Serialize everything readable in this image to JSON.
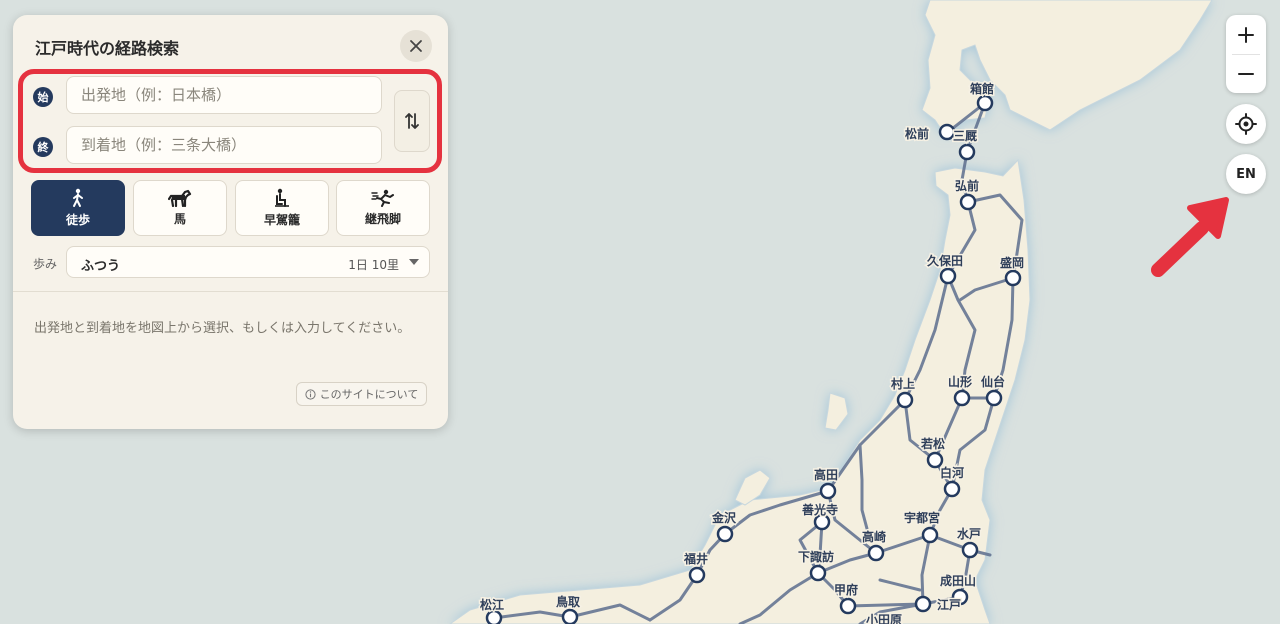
{
  "panel": {
    "title": "江戸時代の経路検索",
    "start": {
      "pin": "始",
      "placeholder": "出発地（例：日本橋）",
      "value": ""
    },
    "end": {
      "pin": "終",
      "placeholder": "到着地（例：三条大橋）",
      "value": ""
    },
    "modes": [
      {
        "label": "徒歩",
        "icon": "walking-person-icon",
        "active": true
      },
      {
        "label": "馬",
        "icon": "horse-icon",
        "active": false
      },
      {
        "label": "早駕籠",
        "icon": "palanquin-icon",
        "active": false
      },
      {
        "label": "継飛脚",
        "icon": "running-courier-icon",
        "active": false
      }
    ],
    "pace": {
      "label": "歩み",
      "value": "ふつう",
      "rate": "1日 10里"
    },
    "instructions": "出発地と到着地を地図上から選択、もしくは入力してください。",
    "about": {
      "icon": "info-icon",
      "label": "このサイトについて"
    }
  },
  "controls": {
    "zoom_in": "+",
    "zoom_out": "−",
    "locate": "locate-crosshair-icon",
    "language": "EN"
  },
  "colors": {
    "accent_navy": "#243a5e",
    "highlight_red": "#e5323f",
    "land": "#f4efdf",
    "sea": "#d9e1df",
    "road": "#5d6e8e"
  },
  "map": {
    "cities": [
      "箱館",
      "松前",
      "三厩",
      "弘前",
      "久保田",
      "盛岡",
      "村上",
      "山形",
      "仙台",
      "若松",
      "白河",
      "高田",
      "金沢",
      "善光寺",
      "高崎",
      "宇都宮",
      "水戸",
      "福井",
      "下諏訪",
      "甲府",
      "江戸",
      "成田山",
      "松江",
      "鳥取",
      "小田原"
    ]
  }
}
